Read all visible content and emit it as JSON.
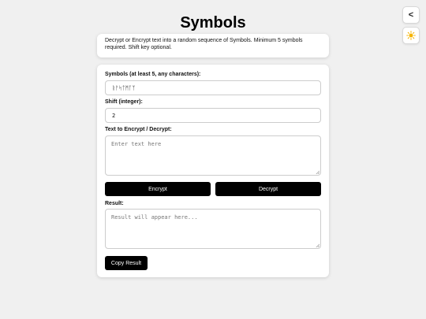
{
  "page": {
    "title": "Symbols"
  },
  "nav": {
    "back_label": "<"
  },
  "description": "Decrypt or Encrypt text into a random sequence of Symbols. Minimum 5 symbols required. Shift key optional.",
  "form": {
    "symbols_label": "Symbols (at least 5, any characters):",
    "symbols_value": "ᚱᚨᛋᛏᛗᚪᛉ",
    "shift_label": "Shift (integer):",
    "shift_value": "2",
    "text_label": "Text to Encrypt / Decrypt:",
    "text_placeholder": "Enter text here",
    "encrypt_label": "Encrypt",
    "decrypt_label": "Decrypt",
    "result_label": "Result:",
    "result_placeholder": "Result will appear here...",
    "copy_label": "Copy Result"
  },
  "icons": {
    "theme": "sun-icon",
    "back": "chevron-left-icon"
  },
  "colors": {
    "button_bg": "#000000",
    "sun": "#f5b400",
    "background": "#f0f0f0"
  }
}
